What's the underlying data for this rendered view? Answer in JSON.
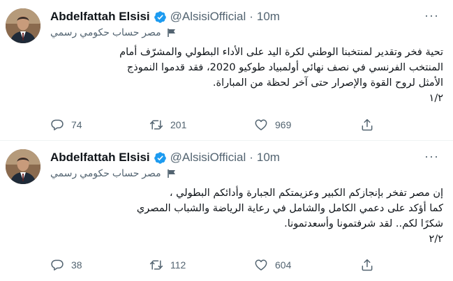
{
  "tweets": [
    {
      "author": {
        "name": "Abdelfattah Elsisi",
        "handle": "@AlsisiOfficial",
        "verified": true
      },
      "separator": "·",
      "time": "10m",
      "label": "مصر حساب حكومي رسمي",
      "body_lines": [
        "تحية فخر وتقدير لمنتخبنا الوطني لكرة اليد على الأداء البطولي والمشرّف أمام",
        "المنتخب الفرنسي في نصف نهائي أولمبياد طوكيو 2020، فقد قدموا النموذج",
        "الأمثل لروح القوة والإصرار حتى آخر لحظة من المباراة.",
        "١/٢"
      ],
      "stats": {
        "replies": "74",
        "retweets": "201",
        "likes": "969"
      }
    },
    {
      "author": {
        "name": "Abdelfattah Elsisi",
        "handle": "@AlsisiOfficial",
        "verified": true
      },
      "separator": "·",
      "time": "10m",
      "label": "مصر حساب حكومي رسمي",
      "body_lines": [
        "إن مصر تفخر بإنجازكم الكبير وعزيمتكم الجبارة وأدائكم البطولي ،",
        "كما أؤكد على دعمي الكامل والشامل في رعاية الرياضة والشباب المصري",
        "شكرًا لكم.. لقد شرفتمونا وأسعدتمونا.",
        "٢/٢"
      ],
      "stats": {
        "replies": "38",
        "retweets": "112",
        "likes": "604"
      }
    }
  ],
  "icons": {
    "reply": "reply-icon",
    "retweet": "retweet-icon",
    "like": "heart-icon",
    "share": "share-icon",
    "verified": "verified-badge-icon",
    "label": "flag-icon",
    "more": "more-icon"
  },
  "colors": {
    "text": "#0f1419",
    "secondary": "#536471",
    "verified": "#1d9bf0",
    "divider": "#eff3f4"
  }
}
